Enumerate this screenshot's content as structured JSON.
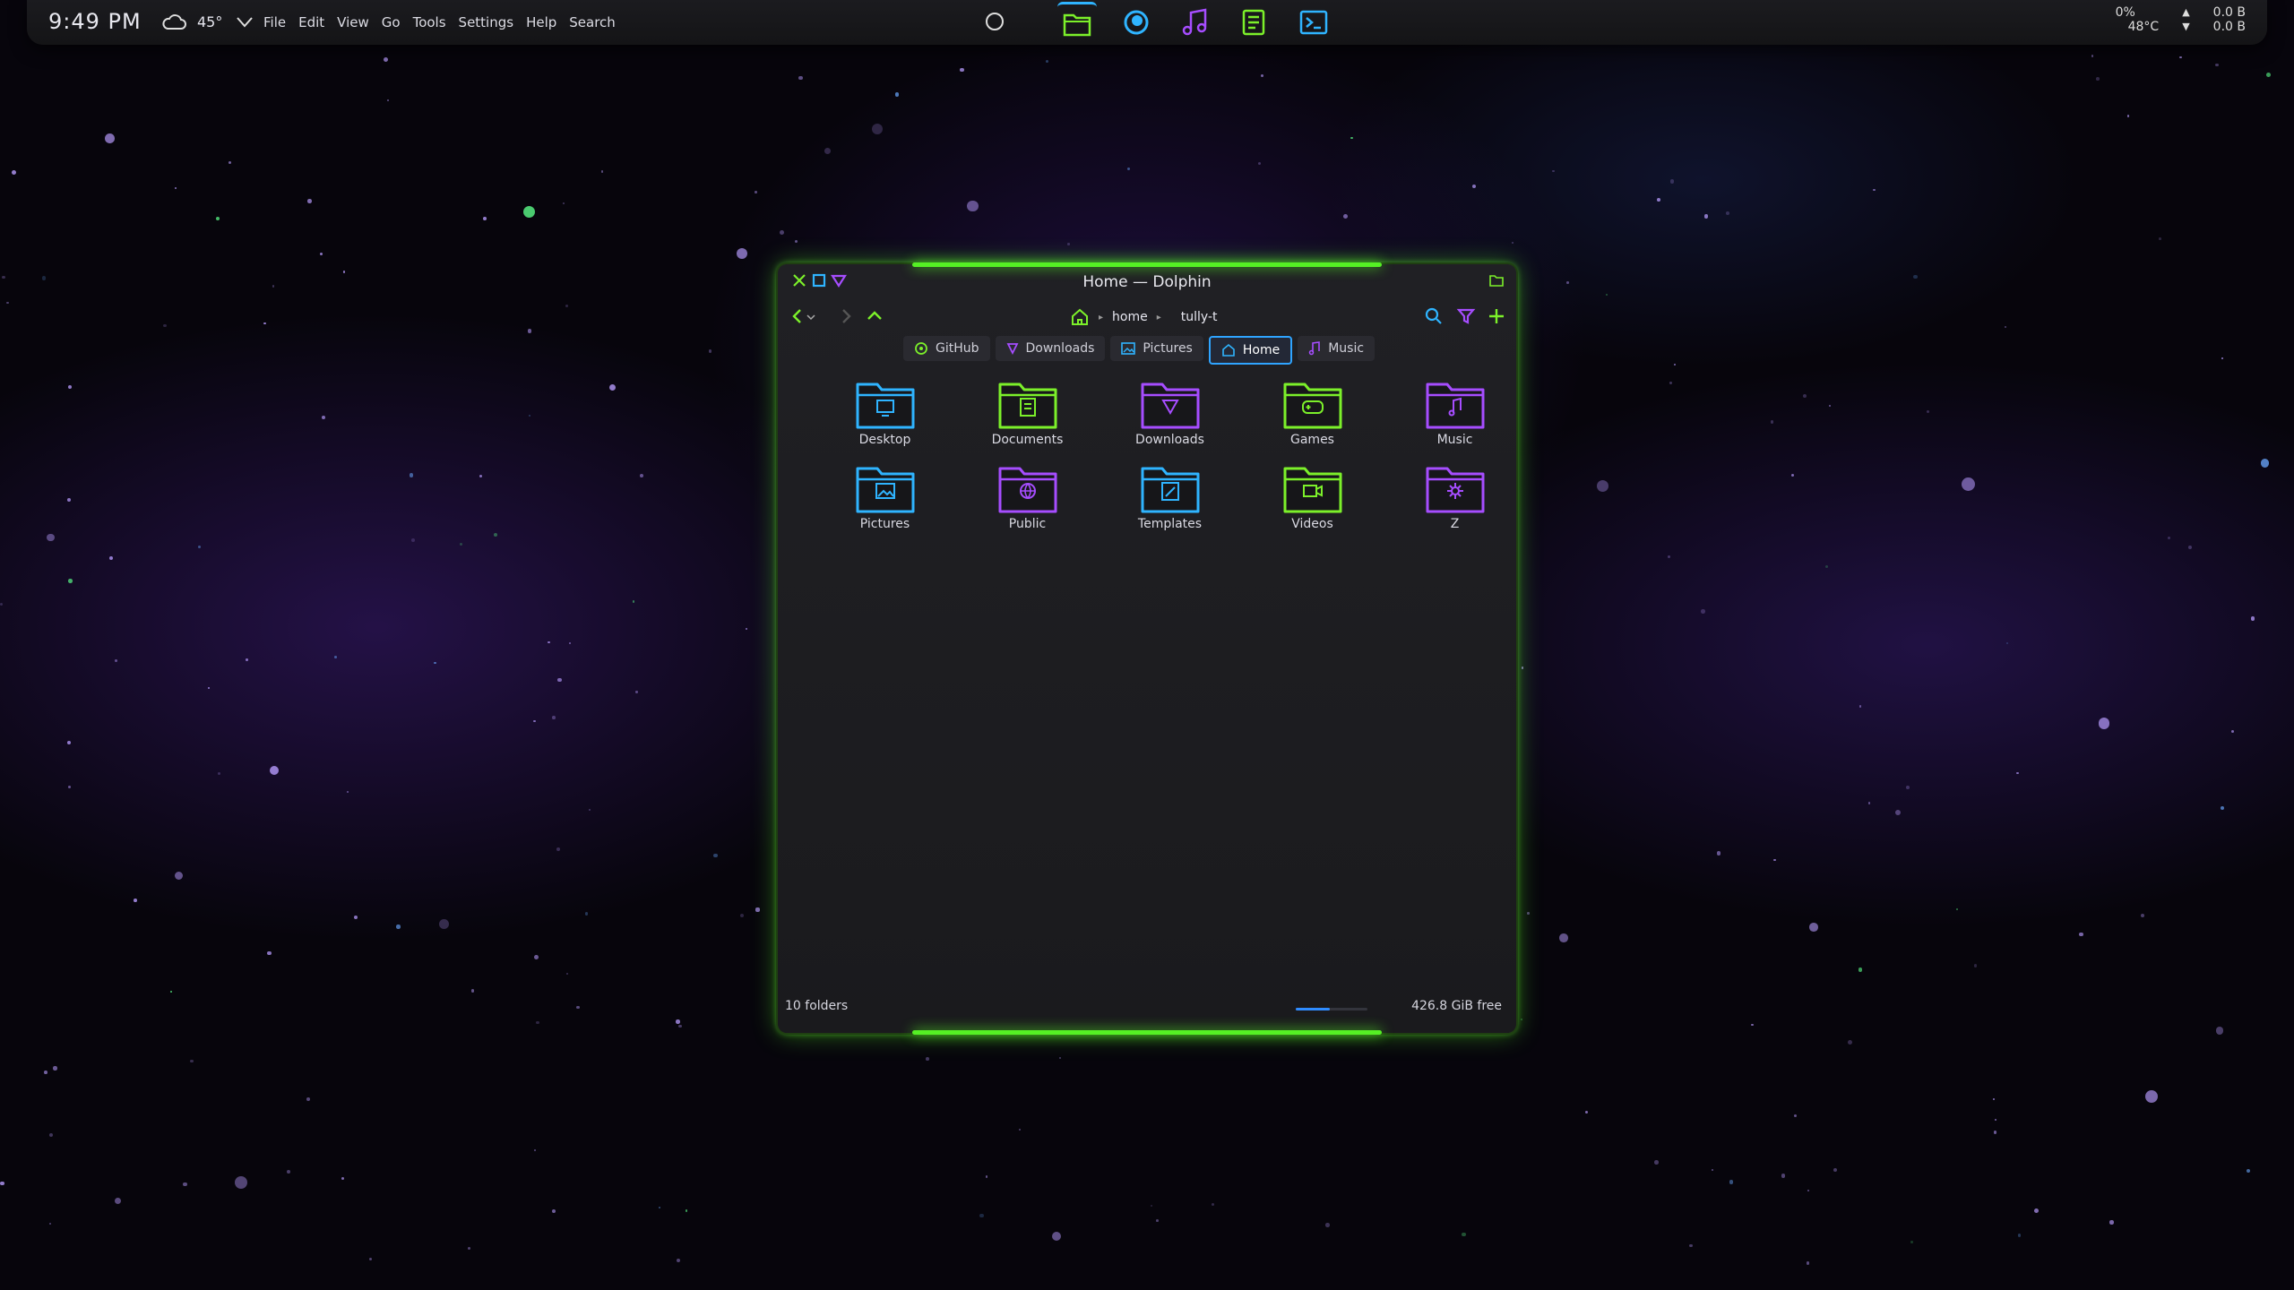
{
  "panel": {
    "clock": "9:49 PM",
    "weather_icon": "cloud-icon",
    "temperature": "45°",
    "menu": [
      "File",
      "Edit",
      "View",
      "Go",
      "Tools",
      "Settings",
      "Help",
      "Search"
    ],
    "dock": [
      {
        "name": "folder-icon",
        "color": "#7cf02a"
      },
      {
        "name": "browser-icon",
        "color": "#2fb4ff"
      },
      {
        "name": "music-note-icon",
        "color": "#a64dff"
      },
      {
        "name": "notes-icon",
        "color": "#7cf02a"
      },
      {
        "name": "terminal-icon",
        "color": "#2fb4ff"
      }
    ],
    "cpu": "0%",
    "cpu_temp": "48°C",
    "net_up": "0.0 B",
    "net_down": "0.0 B"
  },
  "window": {
    "title": "Home — Dolphin",
    "breadcrumb": [
      "home",
      "tully-t"
    ],
    "places": [
      {
        "label": "GitHub",
        "icon": "github-icon",
        "color": "#7cf02a"
      },
      {
        "label": "Downloads",
        "icon": "download-icon",
        "color": "#a64dff"
      },
      {
        "label": "Pictures",
        "icon": "picture-icon",
        "color": "#2fb4ff"
      },
      {
        "label": "Home",
        "icon": "home-icon",
        "color": "#2fb4ff",
        "active": true
      },
      {
        "label": "Music",
        "icon": "music-note-icon",
        "color": "#a64dff"
      }
    ],
    "folders": [
      {
        "label": "Desktop",
        "color": "#2fb4ff"
      },
      {
        "label": "Documents",
        "color": "#7cf02a"
      },
      {
        "label": "Downloads",
        "color": "#a64dff"
      },
      {
        "label": "Games",
        "color": "#7cf02a"
      },
      {
        "label": "Music",
        "color": "#a64dff"
      },
      {
        "label": "Pictures",
        "color": "#2fb4ff"
      },
      {
        "label": "Public",
        "color": "#a64dff"
      },
      {
        "label": "Templates",
        "color": "#2fb4ff"
      },
      {
        "label": "Videos",
        "color": "#7cf02a"
      },
      {
        "label": "Z",
        "color": "#a64dff"
      }
    ],
    "status_left": "10 folders",
    "status_right": "426.8 GiB free",
    "disk_used_fraction": 0.48
  },
  "colors": {
    "accent_green": "#55f024",
    "accent_blue": "#2fb4ff",
    "accent_purple": "#a64dff"
  }
}
